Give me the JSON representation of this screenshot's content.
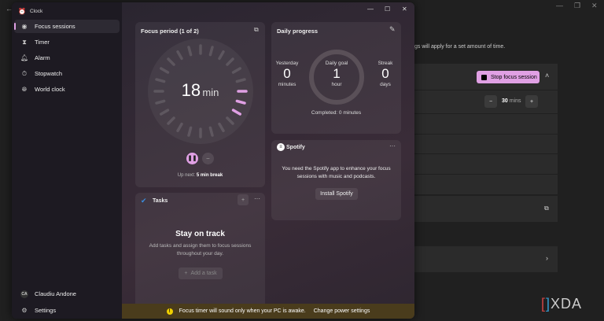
{
  "background_window": {
    "hint": "gs will apply for a set amount of time.",
    "stop_button": "Stop focus session",
    "duration_value": "30",
    "duration_unit": "mins"
  },
  "app": {
    "title": "Clock"
  },
  "sidebar": {
    "items": [
      {
        "label": "Focus sessions",
        "icon": "focus-icon",
        "selected": true
      },
      {
        "label": "Timer",
        "icon": "hourglass-icon"
      },
      {
        "label": "Alarm",
        "icon": "bell-icon"
      },
      {
        "label": "Stopwatch",
        "icon": "stopwatch-icon"
      },
      {
        "label": "World clock",
        "icon": "globe-icon"
      }
    ],
    "user": {
      "initials": "CA",
      "name": "Claudiu Andone"
    },
    "settings": "Settings"
  },
  "focus": {
    "title": "Focus period (1 of 2)",
    "time": "18",
    "unit": "min",
    "up_next_label": "Up next:",
    "up_next_value": "5 min break"
  },
  "daily": {
    "title": "Daily progress",
    "yesterday_label": "Yesterday",
    "yesterday_value": "0",
    "yesterday_unit": "minutes",
    "goal_label": "Daily goal",
    "goal_value": "1",
    "goal_unit": "hour",
    "streak_label": "Streak",
    "streak_value": "0",
    "streak_unit": "days",
    "completed": "Completed: 0 minutes"
  },
  "spotify": {
    "title": "Spotify",
    "message": "You need the Spotify app to enhance your focus sessions with music and podcasts.",
    "install": "Install Spotify"
  },
  "tasks": {
    "title": "Tasks",
    "heading": "Stay on track",
    "message": "Add tasks and assign them to focus sessions throughout your day.",
    "add": "Add a task"
  },
  "banner": {
    "message": "Focus timer will sound only when your PC is awake.",
    "link": "Change power settings",
    "color": "#4a3c1c"
  },
  "accent": "#e0a0e4",
  "watermark": "XDA"
}
